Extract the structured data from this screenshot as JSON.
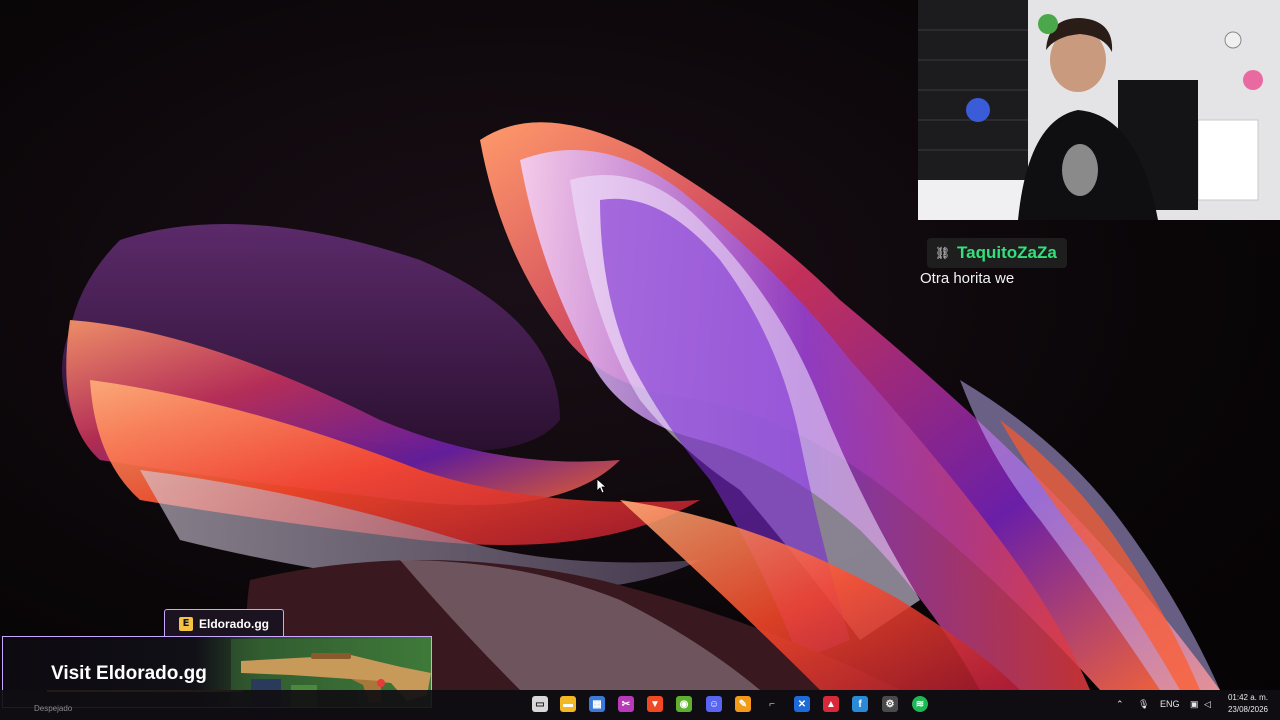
{
  "chat": {
    "username": "TaquitoZaZa",
    "message": "Otra horita we"
  },
  "sponsor": {
    "tab_label": "Eldorado.gg",
    "banner_text": "Visit Eldorado.gg"
  },
  "taskbar": {
    "left_text": "Despejado",
    "icons": [
      "task-view-icon",
      "file-explorer-icon",
      "microsoft-store-icon",
      "snipping-tool-icon",
      "brave-browser-icon",
      "nvidia-icon",
      "discord-icon",
      "app-icon",
      "app-icon",
      "app-icon",
      "app-icon",
      "app-icon",
      "spotify-icon"
    ],
    "tray": {
      "language": "ENG",
      "time": "01:42 a. m.",
      "date": "23/08/2026"
    }
  },
  "colors": {
    "chat_name": "#34e07b",
    "sponsor_border": "#caa7ff",
    "sponsor_accent": "#f5c242"
  }
}
